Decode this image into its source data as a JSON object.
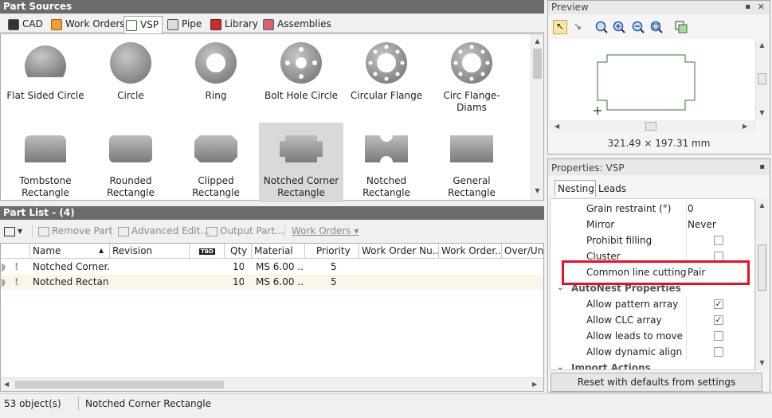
{
  "part_sources": {
    "title": "Part Sources",
    "tabs": [
      {
        "label": "CAD"
      },
      {
        "label": "Work Orders"
      },
      {
        "label": "VSP"
      },
      {
        "label": "Pipe"
      },
      {
        "label": "Library"
      },
      {
        "label": "Assemblies"
      }
    ],
    "parts": [
      {
        "label": "Flat Sided Circle"
      },
      {
        "label": "Circle"
      },
      {
        "label": "Ring"
      },
      {
        "label": "Bolt Hole Circle"
      },
      {
        "label": "Circular Flange"
      },
      {
        "label": "Circ Flange-Diams"
      },
      {
        "label": "Tombstone Rectangle"
      },
      {
        "label": "Rounded Rectangle"
      },
      {
        "label": "Clipped Rectangle"
      },
      {
        "label": "Notched Corner Rectangle"
      },
      {
        "label": "Notched Rectangle"
      },
      {
        "label": "General Rectangle"
      }
    ]
  },
  "part_list": {
    "title": "Part List  -  (4)",
    "toolbar": {
      "remove": "Remove Part",
      "advanced": "Advanced Edit...",
      "output": "Output Part...",
      "work_orders": "Work Orders"
    },
    "columns": [
      "Name",
      "Revision",
      "TBD",
      "Qty",
      "Material",
      "Priority",
      "Work Order Nu...",
      "Work Order...",
      "Over/Und"
    ],
    "rows": [
      {
        "name": "Notched Corner...",
        "qty": "10",
        "material": "MS 6.00 ...",
        "priority": "5"
      },
      {
        "name": "Notched Rectan...",
        "qty": "10",
        "material": "MS 6.00 ...",
        "priority": "5"
      }
    ]
  },
  "preview": {
    "title": "Preview",
    "dimensions": "321.49 × 197.31 mm"
  },
  "properties": {
    "title": "Properties: VSP",
    "tabs": [
      {
        "label": "Nesting"
      },
      {
        "label": "Leads"
      }
    ],
    "rows": [
      {
        "name": "Grain restraint (°)",
        "value": "0"
      },
      {
        "name": "Mirror",
        "value": "Never"
      },
      {
        "name": "Prohibit filling",
        "checked": false
      },
      {
        "name": "Cluster",
        "checked": false
      },
      {
        "name": "Common line cutting",
        "value": "Pair"
      }
    ],
    "section_autonest": "AutoNest Properties",
    "autonest_rows": [
      {
        "name": "Allow pattern array",
        "checked": true
      },
      {
        "name": "Allow CLC array",
        "checked": true
      },
      {
        "name": "Allow leads to move",
        "checked": false
      },
      {
        "name": "Allow dynamic align",
        "checked": false
      }
    ],
    "section_import": "Import Actions",
    "reset_button": "Reset with defaults from settings"
  },
  "status_bar": {
    "count": "53 object(s)",
    "selection": "Notched Corner Rectangle"
  },
  "colors": {
    "highlight": "#e81123",
    "panel_header": "#6b6b6b",
    "selected_part": "#d9d9d9"
  }
}
